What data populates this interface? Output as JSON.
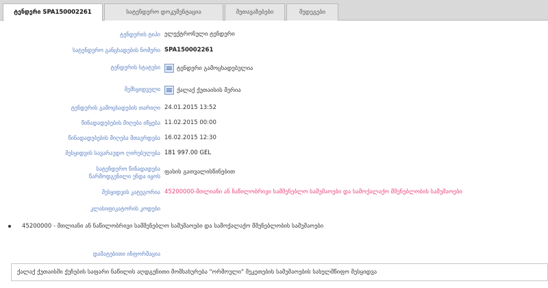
{
  "tabs": [
    {
      "label": "ტენდერი SPA150002261",
      "active": true
    },
    {
      "label": "სატენდერო დოკუმენტაცია",
      "active": false
    },
    {
      "label": "შეთავაზებები",
      "active": false
    },
    {
      "label": "შედეგები",
      "active": false
    }
  ],
  "rows": [
    {
      "label": "ტენდერის ტიპი",
      "value": "ელექტრონული ტენდერი"
    },
    {
      "label": "სატენდერო განცხადების ნომერი",
      "value": "SPA150002261"
    },
    {
      "label": "ტენდერის სტატუსი",
      "value": "ტენდერი გამოცხადებულია"
    },
    {
      "label": "შემსყიდველი",
      "value": "ქალაქ ქუთაისის მერია"
    },
    {
      "label": "ტენდერის გამოცხადების თარიღი",
      "value": "24.01.2015 13:52"
    },
    {
      "label": "წინადადებების მიღება იწყება",
      "value": "11.02.2015 00:00"
    },
    {
      "label": "წინადადებების მიღება მთავრდება",
      "value": "16.02.2015 12:30"
    },
    {
      "label": "შესყიდვის სავარაუდო ღირებულება",
      "value": "181 997.00 GEL"
    },
    {
      "label": "სატენდერო წინადადება\nწარმოდგენილი უნდა იყოს",
      "value": "ფასის გათვალისწინებით"
    },
    {
      "label": "შესყიდვის კატეგორია",
      "value": "45200000-მთლიანი ან ნაწილობრივი სამშენებლო სამუშაოები და სამოქალაქო მშენებლობის სამუშაოები"
    },
    {
      "label": "კლასიფიკატორის კოდები",
      "value": ""
    }
  ],
  "bullet": "45200000 - მთლიანი ან ნაწილობრივი სამშენებლო სამუშაოები და სამოქალაქო მშენებლობის სამუშაოები",
  "extra_label": "დამატებითი ინფორმაცია",
  "note": "ქალაქ ქუთაისში ქუჩების საფარი ნაწილის აღდგენითი მომსახურება \"ორმოული\" შეკეთების სამუშაოების სახელმწიფო შესყიდვა",
  "colors": {
    "label": "#5a7fc2",
    "category": "#e8427a"
  }
}
